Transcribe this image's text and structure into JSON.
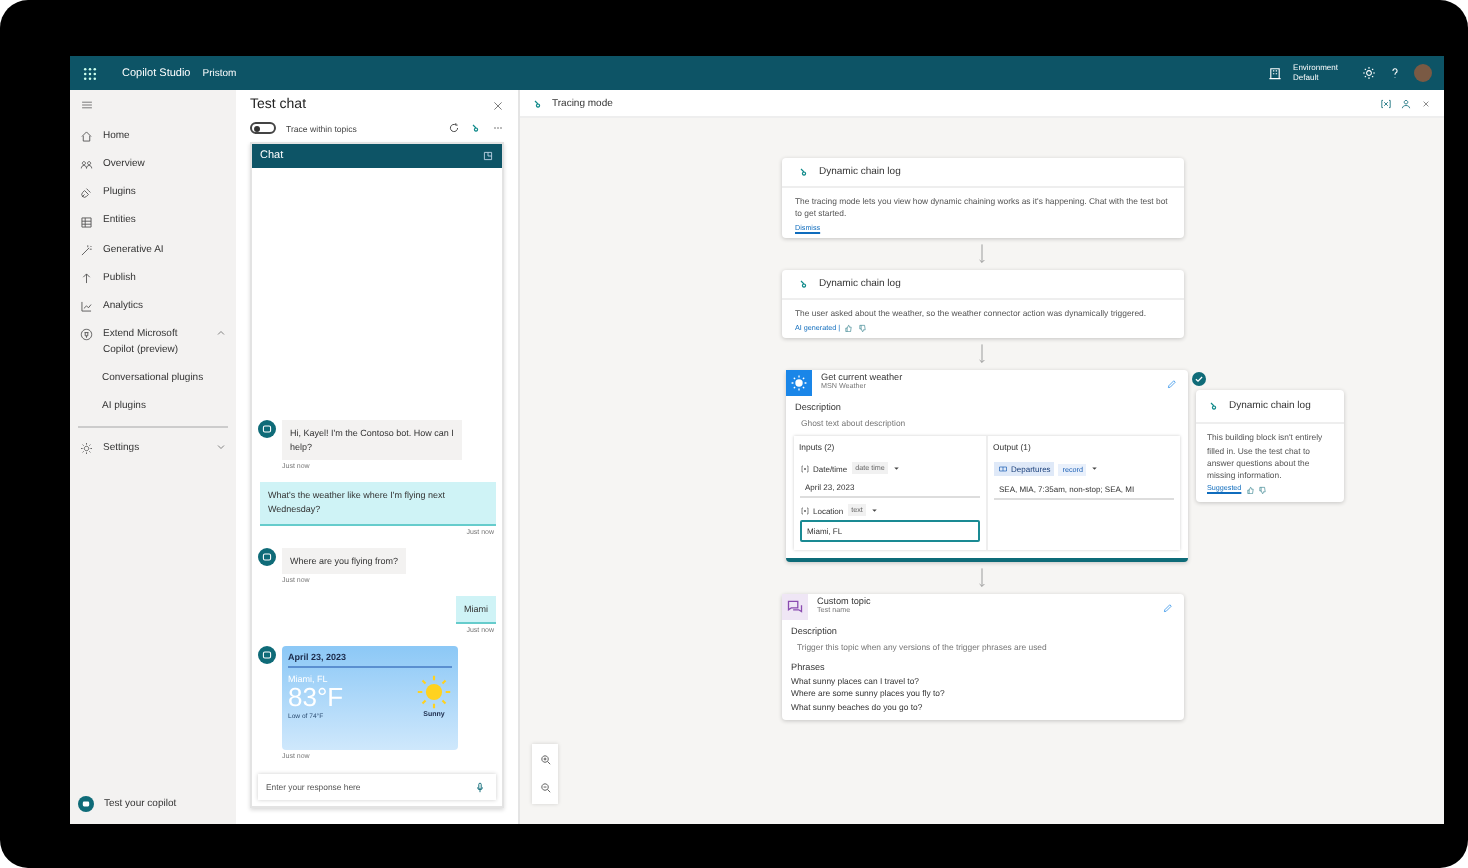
{
  "app_bar": {
    "title": "Copilot Studio",
    "org": "Pristom",
    "environment_label": "Environment",
    "environment_value": "Default"
  },
  "nav": {
    "items": [
      {
        "kind": "link",
        "label": "Home"
      },
      {
        "kind": "link",
        "label": "Overview"
      },
      {
        "kind": "link",
        "label": "Plugins"
      },
      {
        "kind": "link",
        "label": "Entities"
      },
      {
        "kind": "link",
        "label": "Generative AI"
      },
      {
        "kind": "link",
        "label": "Publish"
      },
      {
        "kind": "link",
        "label": "Analytics"
      },
      {
        "kind": "group",
        "label": "Extend Microsoft Copilot (preview)",
        "expanded": true,
        "children": [
          {
            "label": "Conversational plugins"
          },
          {
            "label": "AI plugins"
          }
        ]
      },
      {
        "kind": "group",
        "label": "Settings",
        "expanded": false
      }
    ],
    "test_button": "Test your copilot"
  },
  "chat": {
    "title": "Test chat",
    "trace_toggle": {
      "label": "Trace within topics",
      "on": false
    },
    "header": "Chat",
    "messages": [
      {
        "outgoing": false,
        "kind": "text",
        "text": "Hi, Kayel! I'm the Contoso bot. How can I help?",
        "time": "Just now"
      },
      {
        "outgoing": true,
        "kind": "text",
        "text": "What's the weather like where I'm flying next Wednesday?",
        "time": "Just now"
      },
      {
        "outgoing": false,
        "kind": "text",
        "text": "Where are you flying from?",
        "time": "Just now"
      },
      {
        "outgoing": true,
        "kind": "text",
        "text": "Miami",
        "time": "Just now"
      },
      {
        "outgoing": false,
        "kind": "weather",
        "date": "April 23, 2023",
        "location": "Miami, FL",
        "temperature": "83°F",
        "low": "Low of 74°F",
        "condition": "Sunny",
        "time": "Just now"
      }
    ],
    "input_placeholder": "Enter your response here"
  },
  "canvas": {
    "title": "Tracing mode",
    "nodes": [
      {
        "kind": "log",
        "title": "Dynamic chain log",
        "text": "The tracing mode lets you view how dynamic chaining works as it's happening. Chat with the test bot to get started.",
        "link": "Dismiss"
      },
      {
        "kind": "log",
        "title": "Dynamic chain log",
        "text": "The user asked about the weather, so the weather connector action was dynamically triggered.",
        "note": "AI generated |",
        "feedback": true
      },
      {
        "kind": "action",
        "title": "Get current weather",
        "subtitle": "MSN Weather",
        "description_label": "Description",
        "description": "Ghost text about description",
        "inputs_label": "Inputs (2)",
        "inputs": [
          {
            "name": "Date/time",
            "type": "date time",
            "value": "April 23, 2023",
            "focused": false
          },
          {
            "name": "Location",
            "type": "text",
            "value": "Miami, FL",
            "focused": true
          }
        ],
        "output_label": "Output (1)",
        "outputs": [
          {
            "name": "Departures",
            "type": "record",
            "value": "SEA, MIA, 7:35am, non-stop; SEA, MI"
          }
        ],
        "side_note": {
          "title": "Dynamic chain log",
          "text": "This building block isn't entirely filled in. Use the test chat to answer questions about the missing information.",
          "link": "Suggested",
          "completed": true,
          "feedback": true
        }
      },
      {
        "kind": "topic",
        "title": "Custom topic",
        "subtitle": "Test name",
        "description_label": "Description",
        "description": "Trigger this topic when any versions of the trigger phrases are used",
        "phrases_label": "Phrases",
        "phrases": [
          "What sunny places can I travel to?",
          "Where are some sunny places you fly to?",
          "What sunny beaches do you go to?"
        ]
      }
    ]
  }
}
